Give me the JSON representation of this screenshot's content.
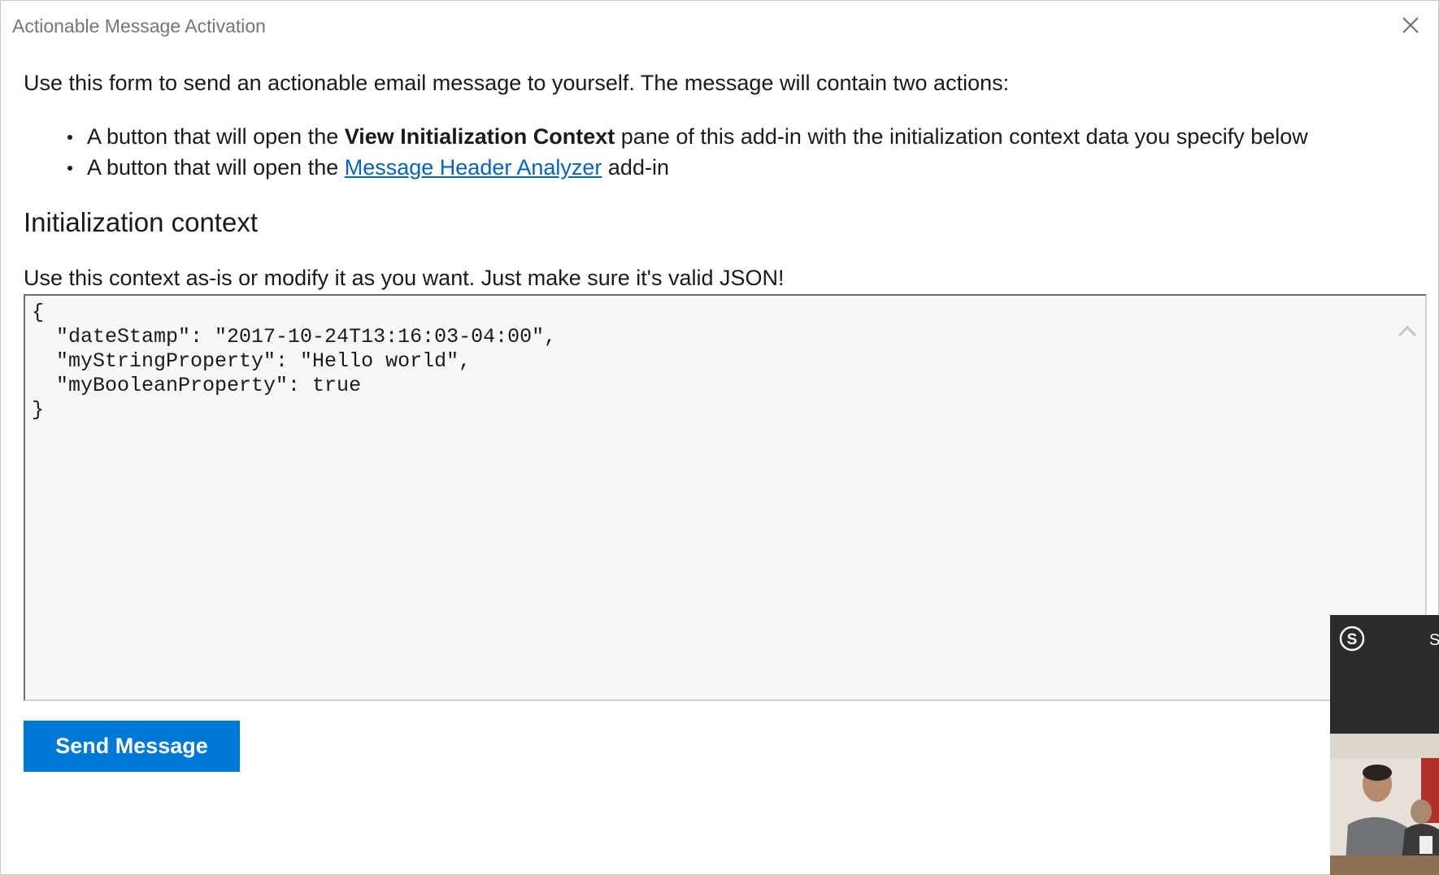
{
  "window": {
    "title": "Actionable Message Activation",
    "close_icon": "close-icon"
  },
  "intro": {
    "text": "Use this form to send an actionable email message to yourself. The message will contain two actions:"
  },
  "actions": [
    {
      "prefix": "A button that will open the ",
      "bold": "View Initialization Context",
      "suffix": " pane of this add-in with the initialization context data you specify below"
    },
    {
      "prefix": "A button that will open the ",
      "link": "Message Header Analyzer",
      "suffix": " add-in"
    }
  ],
  "context": {
    "heading": "Initialization context",
    "label": "Use this context as-is or modify it as you want. Just make sure it's valid JSON!",
    "json_value": "{\n  \"dateStamp\": \"2017-10-24T13:16:03-04:00\",\n  \"myStringProperty\": \"Hello world\",\n  \"myBooleanProperty\": true\n}"
  },
  "send_button": {
    "label": "Send Message"
  },
  "skype": {
    "icon": "skype-icon",
    "label_partial": "S"
  },
  "colors": {
    "accent": "#0078d7",
    "link": "#0563c1",
    "title": "#767676",
    "editor_bg": "#f7f7f7"
  }
}
